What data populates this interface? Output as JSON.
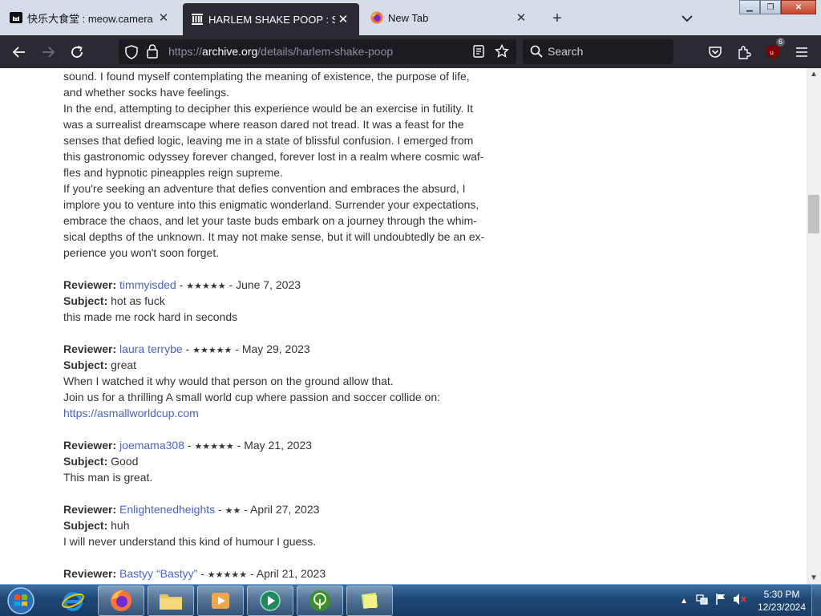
{
  "tabs": [
    {
      "title": "快乐大食堂 : meow.camera",
      "icon": "cat-camera-icon",
      "active": false
    },
    {
      "title": "HARLEM SHAKE POOP : Steezy",
      "icon": "archive-building-icon",
      "active": true
    },
    {
      "title": "New Tab",
      "icon": "firefox-icon",
      "active": false
    }
  ],
  "url": {
    "prefix": "https://",
    "domain": "archive.org",
    "path": "/details/harlem-shake-poop"
  },
  "search_placeholder": "Search",
  "extension_badge": "6",
  "article": {
    "lines": [
      "sound. I found myself contemplating the meaning of existence, the purpose of life,",
      "and whether socks have feelings.",
      "In the end, attempting to decipher this experience would be an exercise in futility. It",
      "was a surrealist dreamscape where reason dared not tread. It was a feast for the",
      "senses that defied logic, leaving me in a state of blissful confusion. I emerged from",
      "this gastronomic odyssey forever changed, forever lost in a realm where cosmic waf-",
      "fles and hypnotic pineapples reign supreme.",
      "If you're seeking an adventure that defies convention and embraces the absurd, I",
      "implore you to venture into this enigmatic wonderland. Surrender your expectations,",
      "embrace the chaos, and let your taste buds embark on a journey through the whim-",
      "sical depths of the unknown. It may not make sense, but it will undoubtedly be an ex-",
      "perience you won't soon forget."
    ]
  },
  "labels": {
    "reviewer": "Reviewer:",
    "subject": "Subject:"
  },
  "reviews": [
    {
      "reviewer": "timmyisded",
      "stars": "★★★★★",
      "date": "June 7, 2023",
      "subject": "hot as fuck",
      "body": [
        "this made me rock hard in seconds"
      ],
      "link": ""
    },
    {
      "reviewer": "laura terrybe",
      "stars": "★★★★★",
      "date": "May 29, 2023",
      "subject": "great",
      "body": [
        "When I watched it why would that person on the ground allow that.",
        "Join us for a thrilling A small world cup where passion and soccer collide on:"
      ],
      "link": "https://asmallworldcup.com"
    },
    {
      "reviewer": "joemama308",
      "stars": "★★★★★",
      "date": "May 21, 2023",
      "subject": "Good",
      "body": [
        "This man is great."
      ],
      "link": ""
    },
    {
      "reviewer": "Enlightenedheights",
      "stars": "★★",
      "date": "April 27, 2023",
      "subject": "huh",
      "body": [
        "I will never understand this kind of humour I guess."
      ],
      "link": ""
    },
    {
      "reviewer": "Bastyy “Bastyy”",
      "stars": "★★★★★",
      "date": "April 21, 2023",
      "subject": "",
      "body": [],
      "link": ""
    }
  ],
  "separator": " - ",
  "taskbar": {
    "items": [
      "firefox-icon",
      "internet-explorer-icon",
      "file-explorer-icon",
      "media-player-icon",
      "media-center-icon",
      "tree-app-icon",
      "notes-app-icon"
    ]
  },
  "clock": {
    "time": "5:30 PM",
    "date": "12/23/2024"
  },
  "colors": {
    "link": "#4b64c7",
    "toolbar": "#2b2a33",
    "active_tab": "#2b2a33"
  }
}
